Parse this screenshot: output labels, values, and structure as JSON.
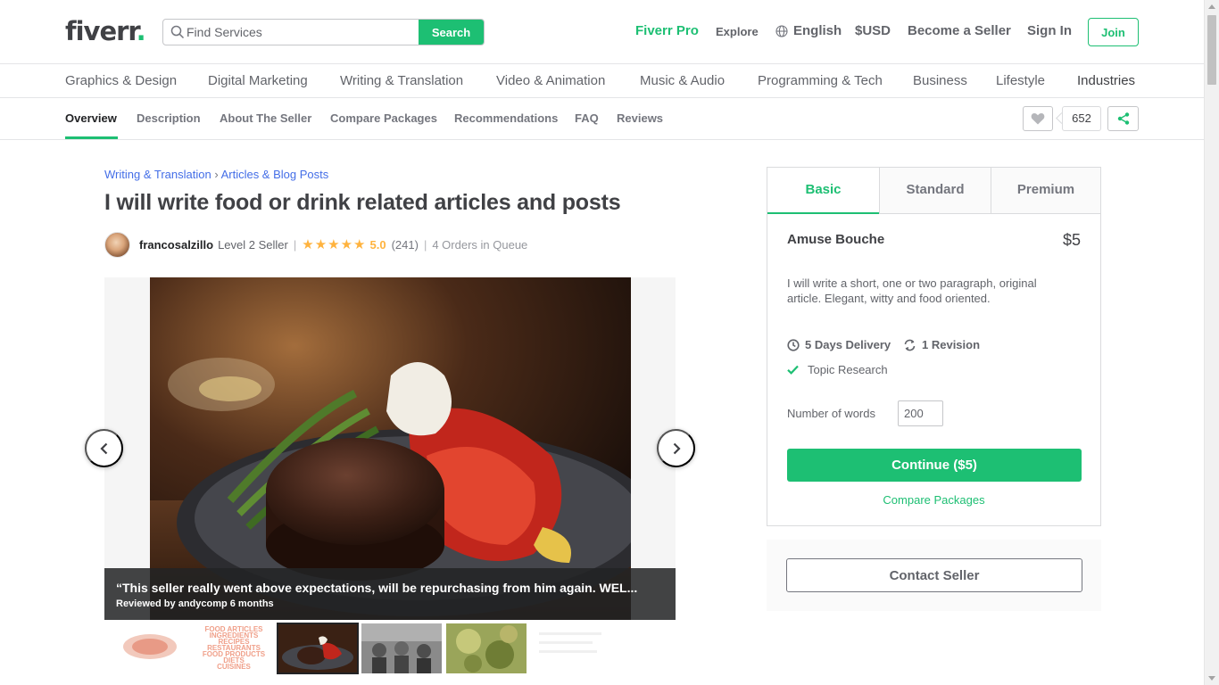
{
  "header": {
    "logo_text": "fiverr",
    "logo_dot": ".",
    "search_placeholder": "Find Services",
    "search_button": "Search",
    "fiverr_pro": "Fiverr Pro",
    "explore": "Explore",
    "language": "English",
    "currency": "$USD",
    "become_seller": "Become a Seller",
    "sign_in": "Sign In",
    "join": "Join"
  },
  "categories": [
    "Graphics & Design",
    "Digital Marketing",
    "Writing & Translation",
    "Video & Animation",
    "Music & Audio",
    "Programming & Tech",
    "Business",
    "Lifestyle",
    "Industries"
  ],
  "subnav": {
    "tabs": [
      "Overview",
      "Description",
      "About The Seller",
      "Compare Packages",
      "Recommendations",
      "FAQ",
      "Reviews"
    ],
    "favorites_count": "652"
  },
  "breadcrumb": {
    "level1": "Writing & Translation",
    "separator": "›",
    "level2": "Articles & Blog Posts"
  },
  "gig": {
    "title": "I will write food or drink related articles and posts",
    "seller_name": "francosalzillo",
    "seller_level": "Level 2 Seller",
    "stars": "★★★★★",
    "rating": "5.0",
    "review_count": "(241)",
    "orders_in_queue": "4 Orders in Queue"
  },
  "gallery": {
    "review_quote": "“This seller really went above expectations, will be repurchasing from him again. WEL...",
    "review_by": "Reviewed by andycomp 6 months",
    "thumb_text_lines": [
      "FOOD ARTICLES",
      "INGREDIENTS",
      "RECIPES",
      "RESTAURANTS",
      "FOOD PRODUCTS",
      "DIETS",
      "CUISINES"
    ]
  },
  "package": {
    "tabs": [
      "Basic",
      "Standard",
      "Premium"
    ],
    "name": "Amuse Bouche",
    "price": "$5",
    "description": "I will write a short, one or two paragraph, original article. Elegant, witty and food oriented.",
    "delivery": "5 Days Delivery",
    "revisions": "1 Revision",
    "feature": "Topic Research",
    "words_label": "Number of words",
    "words_value": "200",
    "continue": "Continue ($5)",
    "compare": "Compare Packages"
  },
  "contact": {
    "button": "Contact Seller"
  },
  "colors": {
    "brand_green": "#1dbf73",
    "star_yellow": "#ffb33e",
    "link_blue": "#446ee7"
  }
}
